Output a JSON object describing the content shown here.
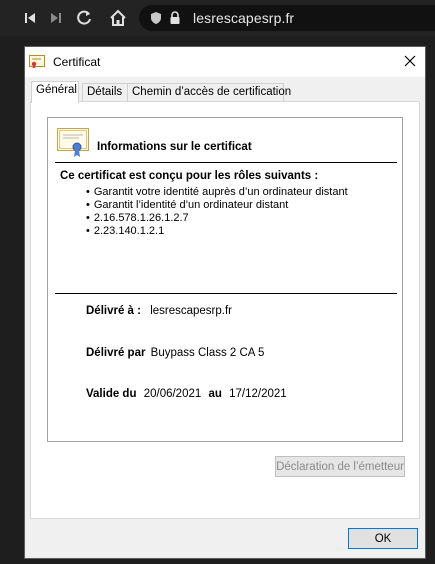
{
  "browser": {
    "url": "lesrescapesrp.fr",
    "icons": [
      "skip-back-icon",
      "skip-forward-icon",
      "reload-icon",
      "home-icon",
      "shield-icon",
      "lock-icon"
    ]
  },
  "dialog": {
    "title": "Certificat",
    "tabs": [
      "Général",
      "Détails",
      "Chemin d’accès de certification"
    ],
    "active_tab": "Général",
    "heading": "Informations sur le certificat",
    "purpose_title": "Ce certificat est conçu pour les rôles suivants :",
    "purposes": [
      "Garantit votre identité auprès d’un ordinateur distant",
      "Garantit l’identité d’un ordinateur distant",
      "2.16.578.1.26.1.2.7",
      "2.23.140.1.2.1"
    ],
    "issued_to_label": "Délivré à :",
    "issued_to": "lesrescapesrp.fr",
    "issued_by_label": "Délivré par",
    "issued_by": "Buypass Class 2 CA 5",
    "valid_from_label": "Valide du",
    "valid_from": "20/06/2021",
    "valid_to_label": "au",
    "valid_to": "17/12/2021",
    "issuer_statement_button": "Déclaration de l’émetteur",
    "ok_button": "OK"
  }
}
